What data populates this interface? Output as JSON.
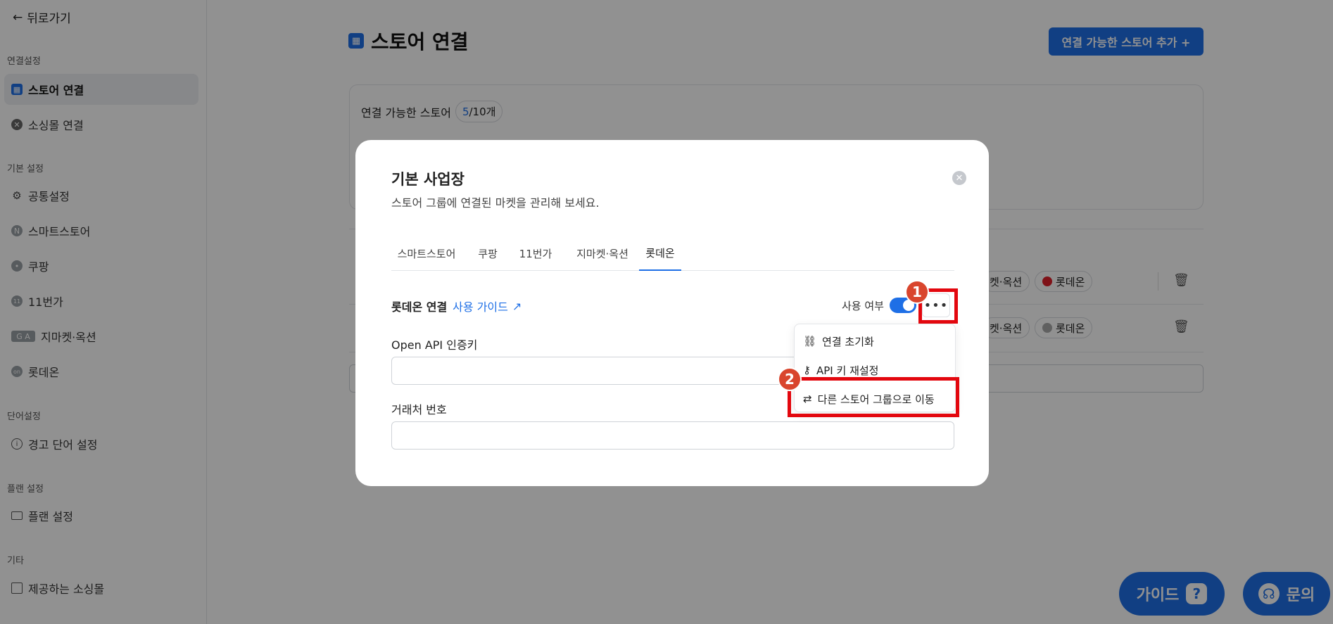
{
  "sidebar": {
    "back_label": "뒤로가기",
    "sections": [
      {
        "title": "연결설정"
      },
      {
        "title": "기본 설정"
      },
      {
        "title": "단어설정"
      },
      {
        "title": "플랜 설정"
      },
      {
        "title": "기타"
      }
    ],
    "items": [
      {
        "label": "스토어 연결",
        "icon": "store-icon"
      },
      {
        "label": "소싱몰 연결",
        "icon": "sourcing-icon"
      },
      {
        "label": "공통설정",
        "icon": "gear-icon"
      },
      {
        "label": "스마트스토어",
        "icon": "naver-icon"
      },
      {
        "label": "쿠팡",
        "icon": "coupang-icon"
      },
      {
        "label": "11번가",
        "icon": "11st-icon"
      },
      {
        "label": "지마켓·옥션",
        "icon": "gmarket-auction-icon"
      },
      {
        "label": "롯데온",
        "icon": "lotteon-icon"
      },
      {
        "label": "경고 단어 설정",
        "icon": "info-icon"
      },
      {
        "label": "플랜 설정",
        "icon": "card-icon"
      },
      {
        "label": "제공하는 소싱몰",
        "icon": "building-icon"
      }
    ]
  },
  "main": {
    "title": "스토어 연결",
    "add_button": "연결 가능한 스토어 추가 +",
    "card_label": "연결 가능한 스토어",
    "count_current": "5",
    "count_total": "/10개",
    "row_tags": [
      "켓·옥션",
      "롯데온"
    ]
  },
  "floating": {
    "guide_label": "가이드",
    "inquiry_label": "문의"
  },
  "modal": {
    "title": "기본 사업장",
    "subtitle": "스토어 그룹에 연결된 마켓을 관리해 보세요.",
    "tabs": [
      "스마트스토어",
      "쿠팡",
      "11번가",
      "지마켓·옥션",
      "롯데온"
    ],
    "active_tab": "롯데온",
    "connection_label": "롯데온 연결",
    "guide_link": "사용 가이드",
    "use_label": "사용 여부",
    "toggle_on": true,
    "more_button": "•••",
    "fields": [
      {
        "label": "Open API 인증키",
        "value": ""
      },
      {
        "label": "거래처 번호",
        "value": ""
      }
    ],
    "menu": [
      {
        "label": "연결 초기화",
        "icon": "unlink-icon"
      },
      {
        "label": "API 키 재설정",
        "icon": "key-icon"
      },
      {
        "label": "다른 스토어 그룹으로 이동",
        "icon": "swap-icon"
      }
    ]
  },
  "annotations": {
    "badge_1": "1",
    "badge_2": "2"
  },
  "colors": {
    "accent": "#1e6fe6",
    "highlight": "#e3070e",
    "badge": "#d9452d"
  }
}
